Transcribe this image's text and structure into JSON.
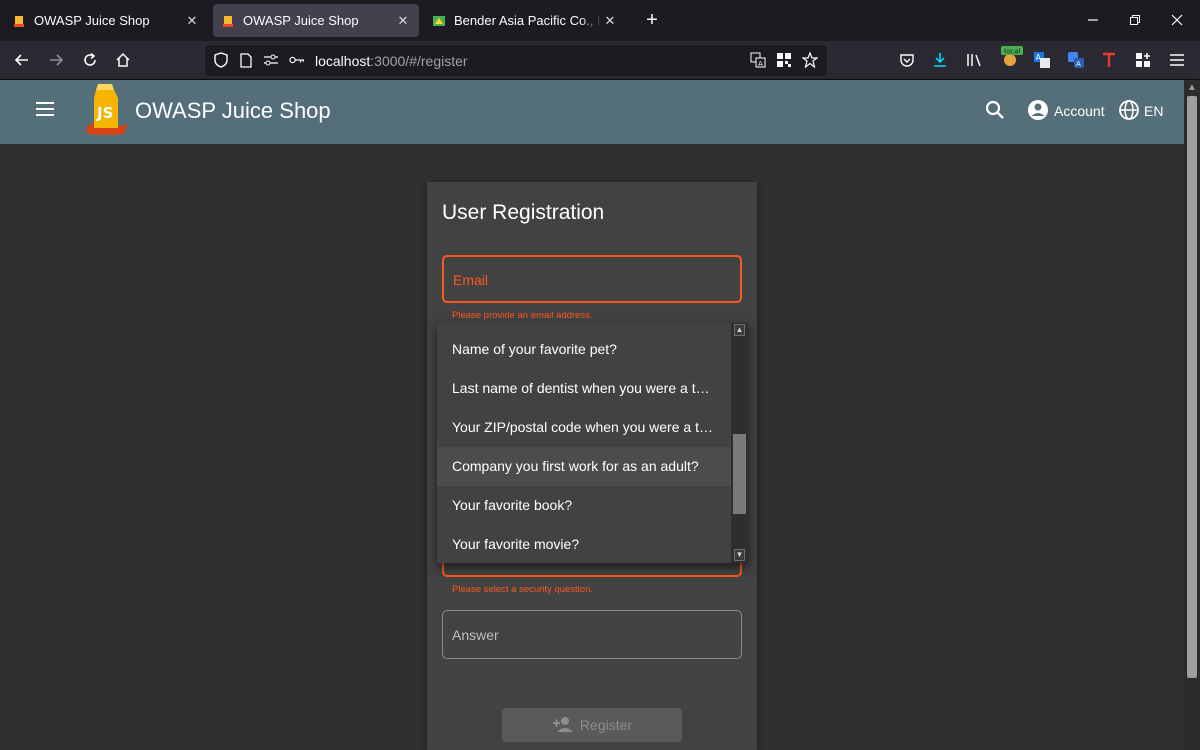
{
  "browser": {
    "tabs": [
      {
        "title": "OWASP Juice Shop",
        "active": false
      },
      {
        "title": "OWASP Juice Shop",
        "active": true
      },
      {
        "title": "Bender Asia Pacific Co., Ltd. - B",
        "active": false
      }
    ],
    "new_tab_label": "+",
    "url": {
      "host": "localhost",
      "rest": ":3000/#/register"
    },
    "toolbar_badge": "local"
  },
  "app": {
    "title": "OWASP Juice Shop",
    "account_label": "Account",
    "language_label": "EN"
  },
  "registration": {
    "title": "User Registration",
    "email_label": "Email",
    "email_error": "Please provide an email address.",
    "security_question_error": "Please select a security question.",
    "answer_label": "Answer",
    "register_button": "Register"
  },
  "security_question_dropdown": {
    "options": [
      "Name of your favorite pet?",
      "Last name of dentist when you were a teenager? (Do not include 'Dr.')",
      "Your ZIP/postal code when you were a teenager?",
      "Company you first work for as an adult?",
      "Your favorite book?",
      "Your favorite movie?"
    ],
    "highlighted": "Company you first work for as an adult?"
  },
  "colors": {
    "toolbar": "#546e7a",
    "error": "#ff5722",
    "card": "#424242",
    "page": "#303030"
  }
}
